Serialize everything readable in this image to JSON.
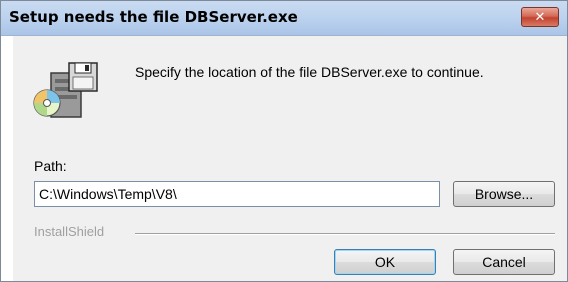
{
  "window": {
    "title": "Setup needs the file DBServer.exe",
    "close_glyph": "✕"
  },
  "content": {
    "icon": "setup-disk-icon",
    "message": "Specify the location of the file DBServer.exe to continue.",
    "path_label": "Path:",
    "path_value": "C:\\Windows\\Temp\\V8\\",
    "browse_label": "Browse...",
    "brand": "InstallShield",
    "ok_label": "OK",
    "cancel_label": "Cancel"
  },
  "colors": {
    "title_bar": "#bcd2ee",
    "close_button": "#c2432f",
    "dialog_bg": "#f0f0f0",
    "default_button_border": "#3c7fb1"
  }
}
